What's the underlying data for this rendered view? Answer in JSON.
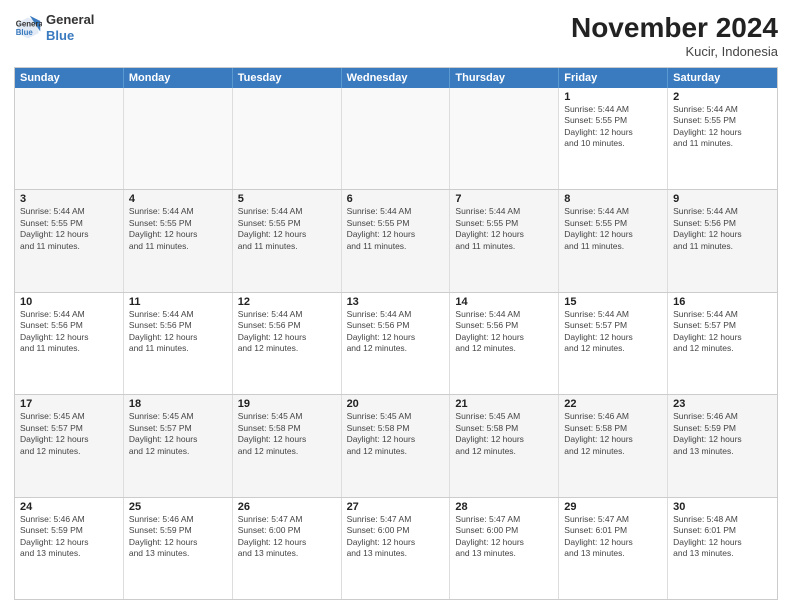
{
  "logo": {
    "line1": "General",
    "line2": "Blue"
  },
  "title": "November 2024",
  "subtitle": "Kucir, Indonesia",
  "header_days": [
    "Sunday",
    "Monday",
    "Tuesday",
    "Wednesday",
    "Thursday",
    "Friday",
    "Saturday"
  ],
  "rows": [
    [
      {
        "day": "",
        "info": "",
        "empty": true
      },
      {
        "day": "",
        "info": "",
        "empty": true
      },
      {
        "day": "",
        "info": "",
        "empty": true
      },
      {
        "day": "",
        "info": "",
        "empty": true
      },
      {
        "day": "",
        "info": "",
        "empty": true
      },
      {
        "day": "1",
        "info": "Sunrise: 5:44 AM\nSunset: 5:55 PM\nDaylight: 12 hours\nand 10 minutes.",
        "empty": false
      },
      {
        "day": "2",
        "info": "Sunrise: 5:44 AM\nSunset: 5:55 PM\nDaylight: 12 hours\nand 11 minutes.",
        "empty": false
      }
    ],
    [
      {
        "day": "3",
        "info": "Sunrise: 5:44 AM\nSunset: 5:55 PM\nDaylight: 12 hours\nand 11 minutes.",
        "empty": false
      },
      {
        "day": "4",
        "info": "Sunrise: 5:44 AM\nSunset: 5:55 PM\nDaylight: 12 hours\nand 11 minutes.",
        "empty": false
      },
      {
        "day": "5",
        "info": "Sunrise: 5:44 AM\nSunset: 5:55 PM\nDaylight: 12 hours\nand 11 minutes.",
        "empty": false
      },
      {
        "day": "6",
        "info": "Sunrise: 5:44 AM\nSunset: 5:55 PM\nDaylight: 12 hours\nand 11 minutes.",
        "empty": false
      },
      {
        "day": "7",
        "info": "Sunrise: 5:44 AM\nSunset: 5:55 PM\nDaylight: 12 hours\nand 11 minutes.",
        "empty": false
      },
      {
        "day": "8",
        "info": "Sunrise: 5:44 AM\nSunset: 5:55 PM\nDaylight: 12 hours\nand 11 minutes.",
        "empty": false
      },
      {
        "day": "9",
        "info": "Sunrise: 5:44 AM\nSunset: 5:56 PM\nDaylight: 12 hours\nand 11 minutes.",
        "empty": false
      }
    ],
    [
      {
        "day": "10",
        "info": "Sunrise: 5:44 AM\nSunset: 5:56 PM\nDaylight: 12 hours\nand 11 minutes.",
        "empty": false
      },
      {
        "day": "11",
        "info": "Sunrise: 5:44 AM\nSunset: 5:56 PM\nDaylight: 12 hours\nand 11 minutes.",
        "empty": false
      },
      {
        "day": "12",
        "info": "Sunrise: 5:44 AM\nSunset: 5:56 PM\nDaylight: 12 hours\nand 12 minutes.",
        "empty": false
      },
      {
        "day": "13",
        "info": "Sunrise: 5:44 AM\nSunset: 5:56 PM\nDaylight: 12 hours\nand 12 minutes.",
        "empty": false
      },
      {
        "day": "14",
        "info": "Sunrise: 5:44 AM\nSunset: 5:56 PM\nDaylight: 12 hours\nand 12 minutes.",
        "empty": false
      },
      {
        "day": "15",
        "info": "Sunrise: 5:44 AM\nSunset: 5:57 PM\nDaylight: 12 hours\nand 12 minutes.",
        "empty": false
      },
      {
        "day": "16",
        "info": "Sunrise: 5:44 AM\nSunset: 5:57 PM\nDaylight: 12 hours\nand 12 minutes.",
        "empty": false
      }
    ],
    [
      {
        "day": "17",
        "info": "Sunrise: 5:45 AM\nSunset: 5:57 PM\nDaylight: 12 hours\nand 12 minutes.",
        "empty": false
      },
      {
        "day": "18",
        "info": "Sunrise: 5:45 AM\nSunset: 5:57 PM\nDaylight: 12 hours\nand 12 minutes.",
        "empty": false
      },
      {
        "day": "19",
        "info": "Sunrise: 5:45 AM\nSunset: 5:58 PM\nDaylight: 12 hours\nand 12 minutes.",
        "empty": false
      },
      {
        "day": "20",
        "info": "Sunrise: 5:45 AM\nSunset: 5:58 PM\nDaylight: 12 hours\nand 12 minutes.",
        "empty": false
      },
      {
        "day": "21",
        "info": "Sunrise: 5:45 AM\nSunset: 5:58 PM\nDaylight: 12 hours\nand 12 minutes.",
        "empty": false
      },
      {
        "day": "22",
        "info": "Sunrise: 5:46 AM\nSunset: 5:58 PM\nDaylight: 12 hours\nand 12 minutes.",
        "empty": false
      },
      {
        "day": "23",
        "info": "Sunrise: 5:46 AM\nSunset: 5:59 PM\nDaylight: 12 hours\nand 13 minutes.",
        "empty": false
      }
    ],
    [
      {
        "day": "24",
        "info": "Sunrise: 5:46 AM\nSunset: 5:59 PM\nDaylight: 12 hours\nand 13 minutes.",
        "empty": false
      },
      {
        "day": "25",
        "info": "Sunrise: 5:46 AM\nSunset: 5:59 PM\nDaylight: 12 hours\nand 13 minutes.",
        "empty": false
      },
      {
        "day": "26",
        "info": "Sunrise: 5:47 AM\nSunset: 6:00 PM\nDaylight: 12 hours\nand 13 minutes.",
        "empty": false
      },
      {
        "day": "27",
        "info": "Sunrise: 5:47 AM\nSunset: 6:00 PM\nDaylight: 12 hours\nand 13 minutes.",
        "empty": false
      },
      {
        "day": "28",
        "info": "Sunrise: 5:47 AM\nSunset: 6:00 PM\nDaylight: 12 hours\nand 13 minutes.",
        "empty": false
      },
      {
        "day": "29",
        "info": "Sunrise: 5:47 AM\nSunset: 6:01 PM\nDaylight: 12 hours\nand 13 minutes.",
        "empty": false
      },
      {
        "day": "30",
        "info": "Sunrise: 5:48 AM\nSunset: 6:01 PM\nDaylight: 12 hours\nand 13 minutes.",
        "empty": false
      }
    ]
  ]
}
